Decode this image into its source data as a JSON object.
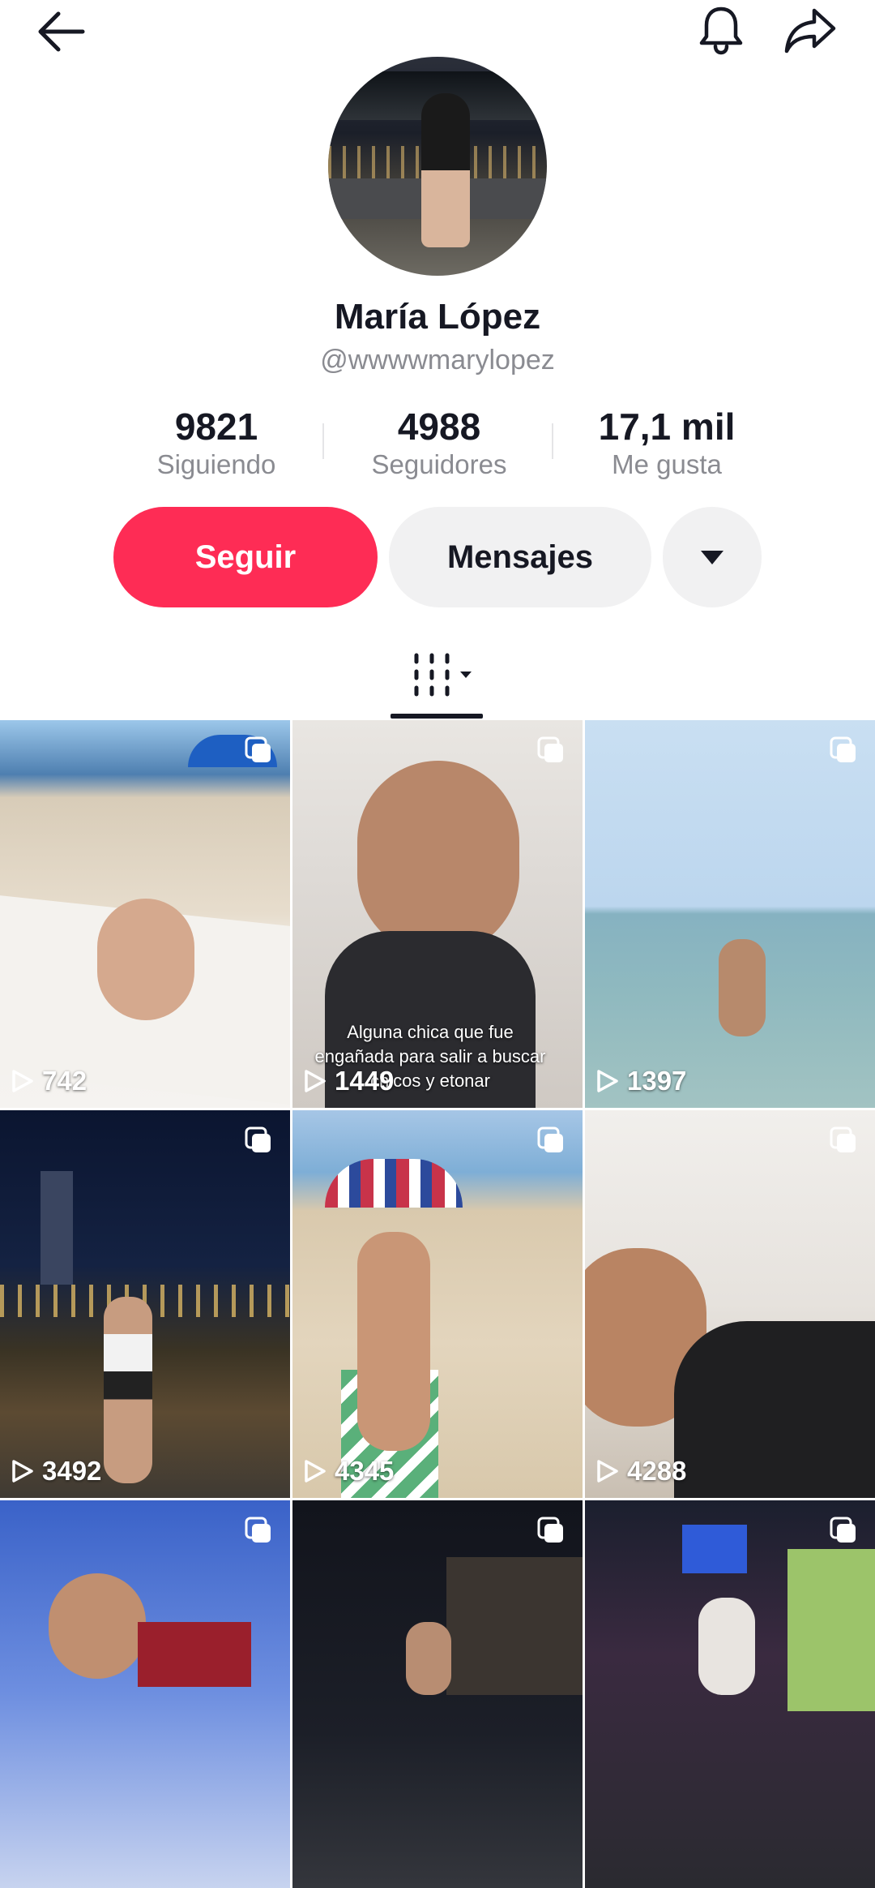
{
  "profile": {
    "name": "María López",
    "handle": "@wwwwmarylopez",
    "stats": [
      {
        "value": "9821",
        "label": "Siguiendo"
      },
      {
        "value": "4988",
        "label": "Seguidores"
      },
      {
        "value": "17,1 mil",
        "label": "Me gusta"
      }
    ]
  },
  "actions": {
    "follow_label": "Seguir",
    "messages_label": "Mensajes"
  },
  "videos": [
    {
      "views": "742"
    },
    {
      "views": "1449",
      "caption": "Alguna chica que fue engañada para salir a buscar chicos y etonar"
    },
    {
      "views": "1397"
    },
    {
      "views": "3492"
    },
    {
      "views": "4345"
    },
    {
      "views": "4288"
    },
    {
      "views": ""
    },
    {
      "views": ""
    },
    {
      "views": ""
    }
  ],
  "colors": {
    "accent": "#fe2c55",
    "secondary_button": "#f1f1f2",
    "muted_text": "#8a8b91"
  },
  "icons": [
    "back-arrow-icon",
    "bell-icon",
    "share-icon",
    "chevron-down-icon",
    "grid-filter-icon",
    "play-icon",
    "multi-photo-icon"
  ]
}
